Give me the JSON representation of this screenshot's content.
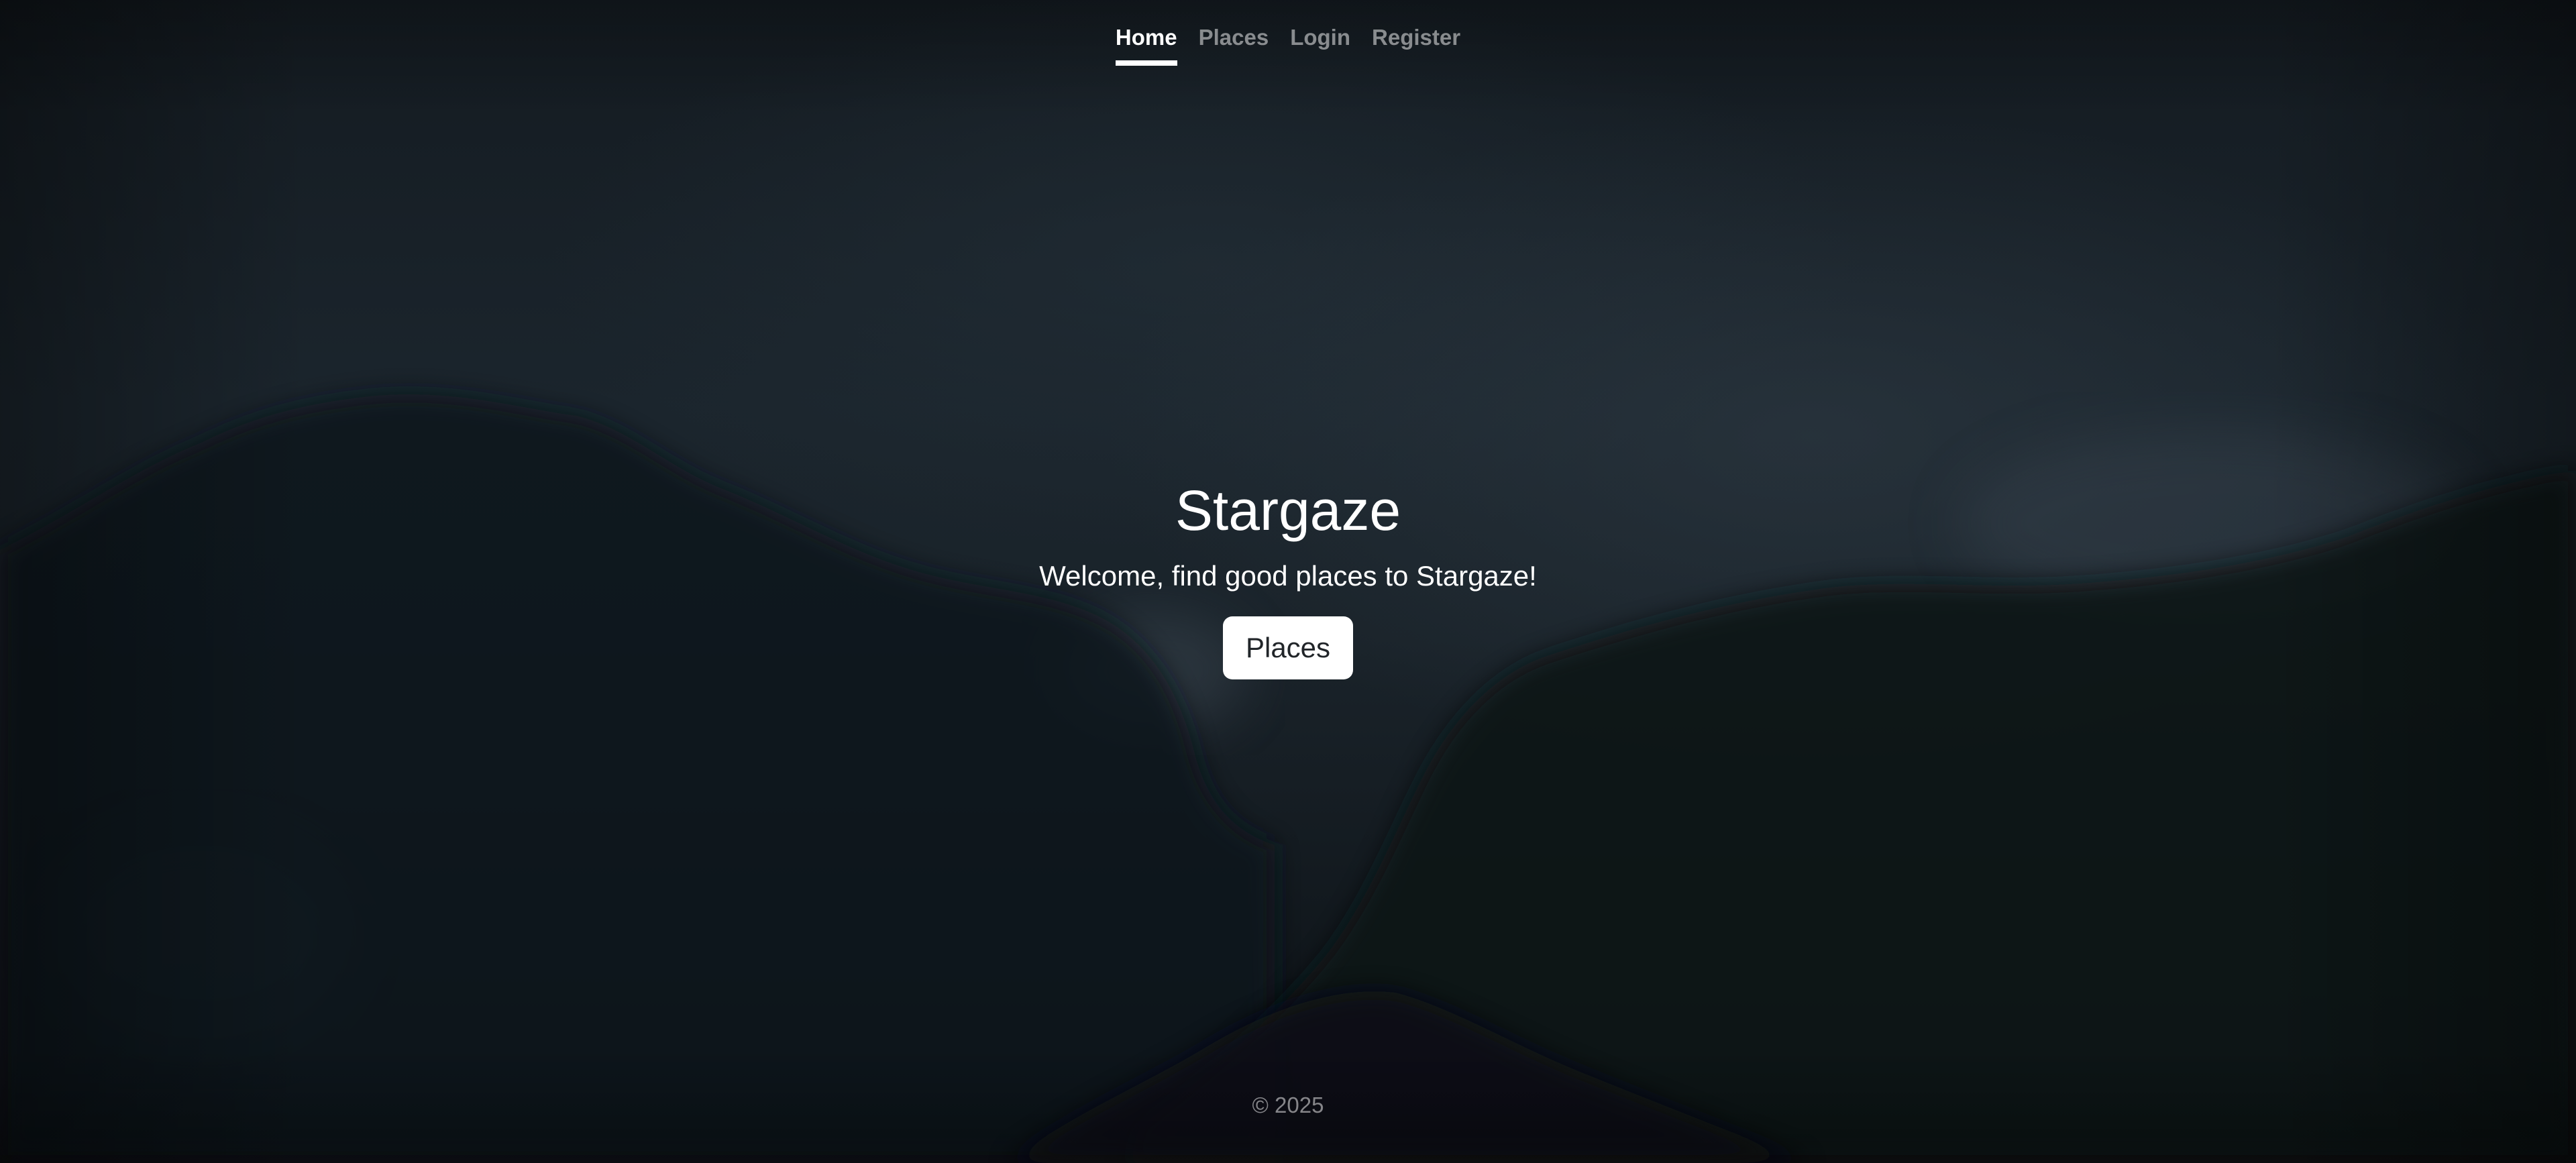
{
  "nav": {
    "items": [
      {
        "label": "Home",
        "active": true
      },
      {
        "label": "Places",
        "active": false
      },
      {
        "label": "Login",
        "active": false
      },
      {
        "label": "Register",
        "active": false
      }
    ]
  },
  "hero": {
    "title": "Stargaze",
    "subtitle": "Welcome, find good places to Stargaze!",
    "button_label": "Places"
  },
  "footer": {
    "text": "© 2025"
  },
  "colors": {
    "background": "#151c22",
    "text": "#ffffff",
    "muted_text": "#8a8f94",
    "button_bg": "#ffffff",
    "button_text": "#212529"
  }
}
